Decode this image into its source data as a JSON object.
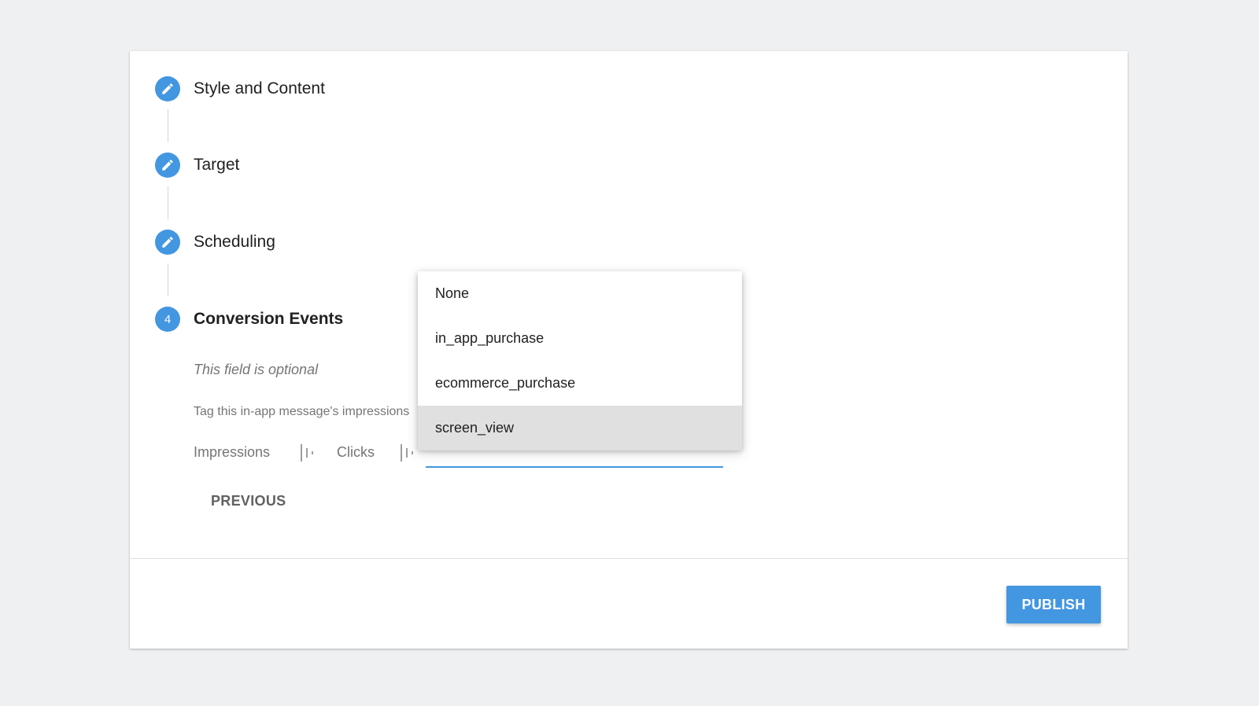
{
  "steps": [
    {
      "label": "Style and Content",
      "icon": "pencil-icon"
    },
    {
      "label": "Target",
      "icon": "pencil-icon"
    },
    {
      "label": "Scheduling",
      "icon": "pencil-icon"
    },
    {
      "label": "Conversion Events",
      "number": "4"
    }
  ],
  "conversion": {
    "optional_text": "This field is optional",
    "description": "Tag this in-app message's impressions",
    "impressions_label": "Impressions",
    "clicks_label": "Clicks",
    "selected_event": "screen_view",
    "options": [
      "None",
      "in_app_purchase",
      "ecommerce_purchase",
      "screen_view"
    ]
  },
  "buttons": {
    "previous": "PREVIOUS",
    "publish": "PUBLISH"
  },
  "colors": {
    "accent": "#4396e0",
    "background": "#eff0f2",
    "selected_option": "#e0e0e0"
  }
}
